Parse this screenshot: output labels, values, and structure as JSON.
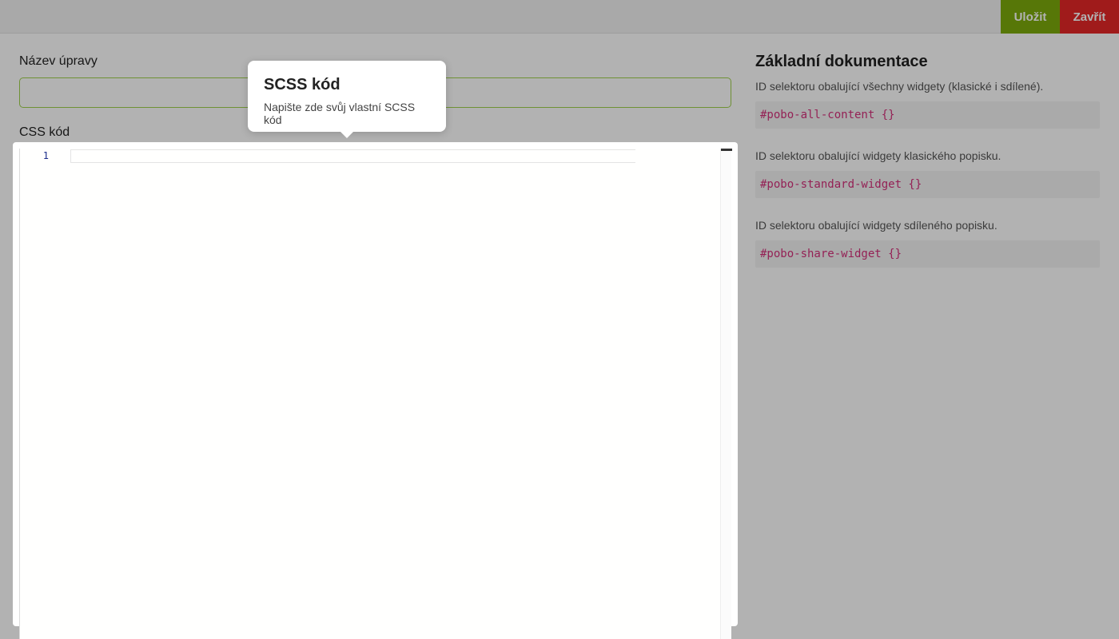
{
  "toolbar": {
    "save_label": "Uložit",
    "close_label": "Zavřít",
    "save_color": "#7dab0c",
    "close_color": "#e52727"
  },
  "form": {
    "name_label": "Název úpravy",
    "name_value": "",
    "css_label": "CSS kód"
  },
  "editor": {
    "line_numbers": [
      "1"
    ],
    "content": ""
  },
  "documentation": {
    "title": "Základní dokumentace",
    "items": [
      {
        "description": "ID selektoru obalující všechny widgety (klasické i sdílené).",
        "code": "#pobo-all-content {}"
      },
      {
        "description": "ID selektoru obalující widgety klasického popisku.",
        "code": "#pobo-standard-widget {}"
      },
      {
        "description": "ID selektoru obalující widgety sdíleného popisku.",
        "code": "#pobo-share-widget {}"
      }
    ]
  },
  "popover": {
    "title": "SCSS kód",
    "text": "Napište zde svůj vlastní SCSS kód"
  }
}
